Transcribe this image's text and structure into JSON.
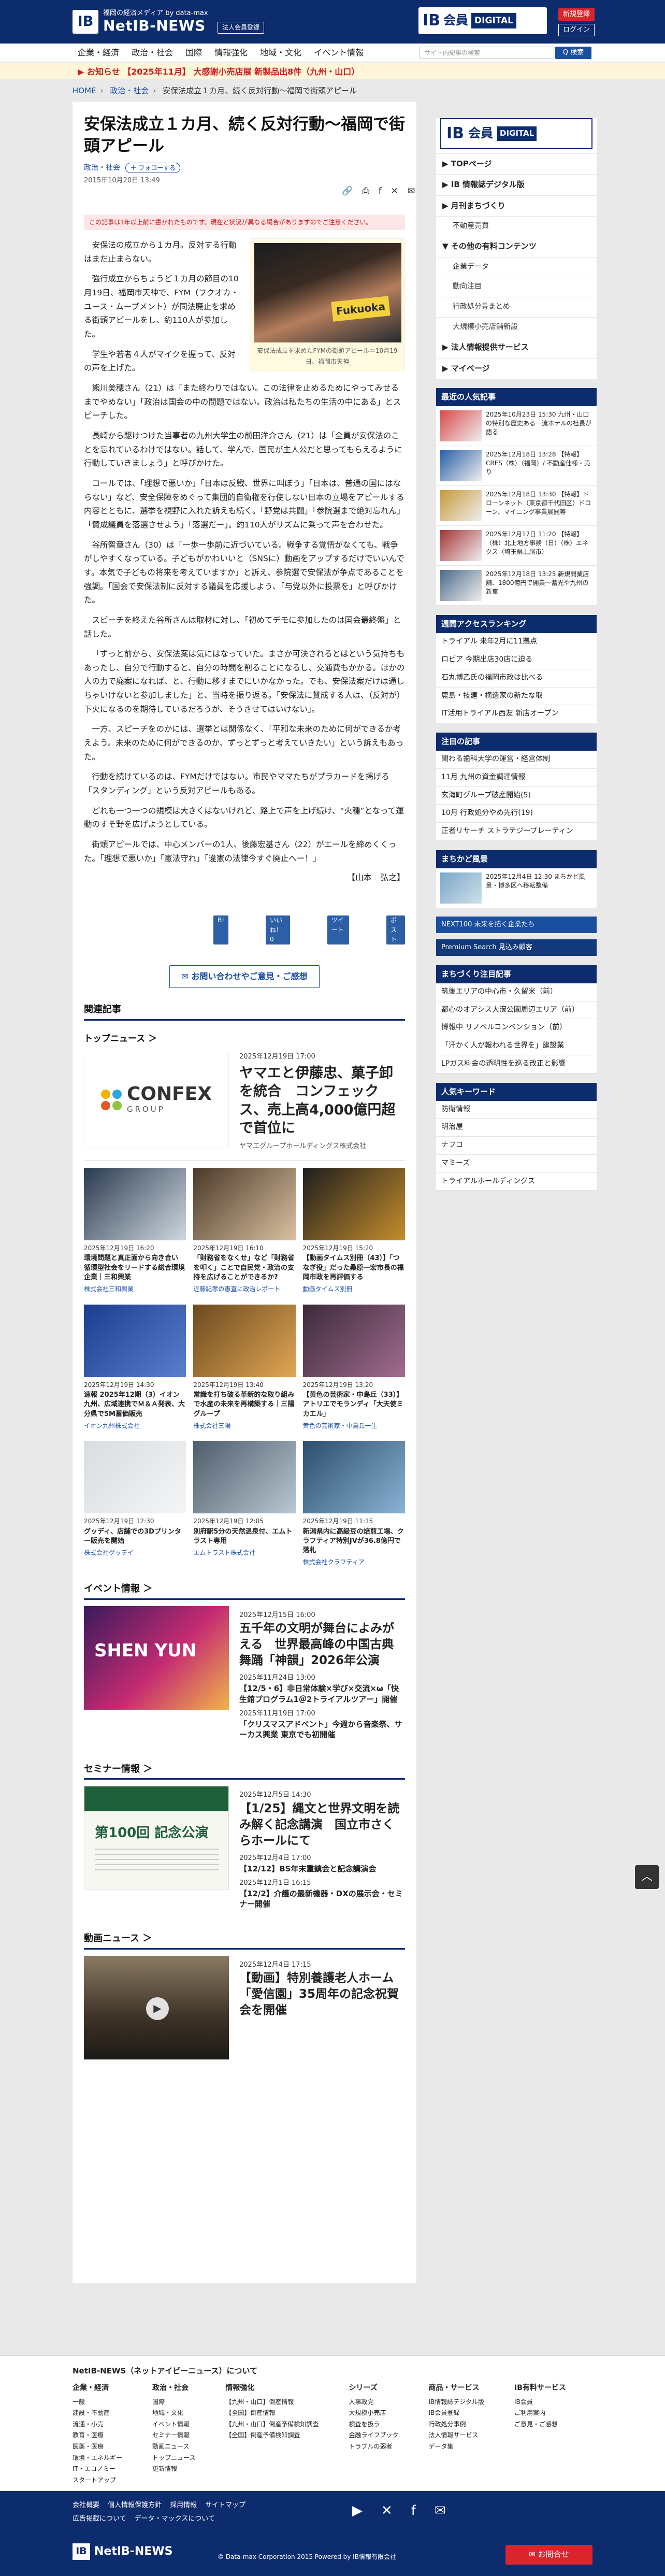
{
  "header": {
    "logo_mark": "IB",
    "logo_sub": "福岡の経済メディア by data-max",
    "logo_name": "NetIB-NEWS",
    "login_pill": "法人会員登録",
    "ib": "IB",
    "member": "会員",
    "digital": "DIGITAL",
    "register": "新規登録",
    "login": "ログイン"
  },
  "nav": {
    "items": [
      "企業・経済",
      "政治・社会",
      "国際",
      "情報強化",
      "地域・文化",
      "イベント情報"
    ],
    "search_placeholder": "サイト内記事の検索",
    "search_button": "Q 検索"
  },
  "notice": "▶ お知らせ  【2025年11月】 大感謝小売店展 新製品出8件（九州・山口）",
  "breadcrumb": [
    "HOME",
    "政治・社会",
    "安保法成立１カ月、続く反対行動～福岡で街頭アピール"
  ],
  "article": {
    "title": "安保法成立１カ月、続く反対行動～福岡で街頭アピール",
    "category": "政治・社会",
    "follow": "＋ フォローする",
    "date": "2015年10月20日 13:49",
    "old_note": "この記事は1年以上前に書かれたものです。現在と状況が異なる場合がありますのでご注意ください。",
    "photo_sign": "Fukuoka",
    "photo_caption": "安保法成立を求めたFYMの街頭アピール＝10月19日、福岡市天神",
    "paragraphs": [
      "安保法の成立から１カ月。反対する行動はまだ止まらない。",
      "強行成立からちょうど１カ月の節目の10月19日、福岡市天神で、FYM（フクオカ・ユース・ムーブメント）が同法廃止を求める街頭アピールをし、約110人が参加した。",
      "学生や若者４人がマイクを握って、反対の声を上げた。",
      "熊川美穂さん（21）は「また終わりではない。この法律を止めるためにやってみせるまでやめない」「政治は国会の中の問題ではない。政治は私たちの生活の中にある」とスピーチした。",
      "長崎から駆けつけた当事者の九州大学生の前田洋介さん（21）は「全員が安保法のことを忘れているわけではない。話して、学んで、国民が主人公だと思ってもらえるように行動していきましょう」と呼びかけた。",
      "コールでは、「理想で悪いか」「日本は反戦、世界に叫ぼう」「日本は、普通の国にはならない」など、安全保障をめぐって集団的自衛権を行使しない日本の立場をアピールする内容とともに、選挙を視野に入れた訴えも続く。「野党は共闘」「参院選まで絶対忘れん」「賛成議員を落選させよう」「落選だー」。約110人がリズムに乗って声を合わせた。",
      "谷所智章さん（30）は「一歩一歩前に近づいている。戦争する覚悟がなくても、戦争がしやすくなっている。子どもがかわいいと（SNSに）動画をアップするだけでいいんです。本気で子どもの将来を考えていますか」と訴え、参院選で安保法が争点であることを強調。「国会で安保法制に反対する議員を応援しよう、「与党以外に投票を」と呼びかけた。",
      "スピーチを終えた谷所さんは取材に対し、「初めてデモに参加したのは国会最終盤」と話した。",
      "「ずっと前から、安保法案は気にはなっていた。まさか可決されるとはという気持ちもあったし、自分で行動すると、自分の時間を削ることになるし、交通費もかかる。ほかの人の力で廃案になれば、と、行動に移すまでにいかなかった。でも、安保法案だけは通しちゃいけないと参加しました」と、当時を振り返る。「安保法に賛成する人は、（反対が）下火になるのを期待しているだろうが、そうさせてはいけない」。",
      "一方、スピーチをのかには、選挙とは関係なく、「平和な未来のために何ができるか考えよう。未来のために何ができるのか、ずっとずっと考えていきたい」という訴えもあった。",
      "行動を続けているのは、FYMだけではない。市民やママたちがプラカードを掲げる「スタンディング」という反対アピールもある。",
      "どれも一つ一つの規模は大きくはないけれど、路上で声を上げ続け、“火種”となって運動のすそ野を広げようとしている。",
      "街頭アピールでは、中心メンバーの1人、後藤宏基さん（22）がエールを締めくくった。「理想で悪いか」「憲法守れ」「違憲の法律今すぐ廃止へー！」"
    ],
    "author": "【山本　弘之】",
    "small_buttons": [
      "B!",
      "いいね！0",
      "ツイート",
      "ポスト"
    ],
    "contact": "✉ お問い合わせやご意見・ご感想"
  },
  "related": {
    "heading": "関連記事",
    "topnews_label": "トップニュース ＞",
    "top_item": {
      "logo_word": "CONFEX",
      "logo_sub": "GROUP",
      "date": "2025年12月19日 17:00",
      "title": "ヤマエと伊藤忠、菓子卸を統合　コンフェックス、売上高4,000億円超で首位に",
      "company": "ヤマエグループホールディングス株式会社"
    },
    "grid": [
      {
        "date": "2025年12月19日 16:20",
        "title": "環境問題と真正面から向き合い 循環型社会をリードする総合環境企業｜三和興業",
        "company": "株式会社三和興業"
      },
      {
        "date": "2025年12月19日 16:10",
        "title": "「財務省をなくせ」など「財務省を叩く」ことで自民党・政治の支持を広げることができるか?",
        "company": "近藤紀孝の愚直に政治レポート"
      },
      {
        "date": "2025年12月19日 15:20",
        "title": "【動画タイムス別冊（43）】「つなぎ役」だった桑原一宏市長の福岡市政を再評価する",
        "company": "動画タイムス別冊"
      },
      {
        "date": "2025年12月19日 14:30",
        "title": "速報 2025年12期（3）イオン九州、広域連携でＭ＆Ａ発表、大分県で5M蓄価販売",
        "company": "イオン九州株式会社"
      },
      {
        "date": "2025年12月19日 13:40",
        "title": "常識を打ち破る革新的な取り組みで水産の未来を再構築する｜三陽グループ",
        "company": "株式会社三陽"
      },
      {
        "date": "2025年12月19日 13:20",
        "title": "【黄色の芸術家・中島丘（33）】アトリエでモランディ「大天使ミカエル」",
        "company": "黄色の芸術家・中島丘一生"
      },
      {
        "date": "2025年12月19日 12:30",
        "title": "グッディ、店舗での3Dプリンター販売を開始",
        "company": "株式会社グッデイ"
      },
      {
        "date": "2025年12月19日 12:05",
        "title": "別府駅5分の天然温泉付、エムトラスト専用",
        "company": "エムトラスト株式会社"
      },
      {
        "date": "2025年12月19日 11:15",
        "title": "新潟県内に高級豆の焙煎工場、クラフティア特別JVが36.8億円で落札",
        "company": "株式会社クラフティア"
      }
    ]
  },
  "events": {
    "heading": "イベント情報 ＞",
    "img_text": "SHEN YUN",
    "items": [
      {
        "date": "2025年12月15日 16:00",
        "title": "五千年の文明が舞台によみがえる　世界最高峰の中国古典舞踊「神韻」2026年公演",
        "big": true
      },
      {
        "date": "2025年11月24日 13:00",
        "title": "【12/5・6】非日常体験×学び×交流×ω「快生館プログラム1＠2トライアルツアー」開催",
        "big": false
      },
      {
        "date": "2025年11月19日 17:00",
        "title": "「クリスマスアドベント」今週から音楽祭、サーカス興業 東京でも初開催",
        "big": false
      }
    ]
  },
  "seminars": {
    "heading": "セミナー情報 ＞",
    "img_text": "第100回 記念公演",
    "items": [
      {
        "date": "2025年12月5日 14:30",
        "title": "【1/25】縄文と世界文明を読み解く記念講演　国立市さくらホールにて",
        "big": true
      },
      {
        "date": "2025年12月4日 17:00",
        "title": "【12/12】BS年末重鎮会と記念講演会",
        "big": false
      },
      {
        "date": "2025年12月1日 16:15",
        "title": "【12/2】介護の最新機器・DXの展示会・セミナー開催",
        "big": false
      }
    ]
  },
  "videos": {
    "heading": "動画ニュース ＞",
    "item": {
      "date": "2025年12月4日 17:15",
      "title": "【動画】特別養護老人ホーム「愛信園」35周年の記念祝賀会を開催"
    }
  },
  "sidebar": {
    "ib": "IB",
    "member": "会員",
    "digital": "DIGITAL",
    "menu": [
      {
        "label": "▶ TOPページ",
        "child": false
      },
      {
        "label": "▶ IB 情報誌デジタル版",
        "child": false
      },
      {
        "label": "▶ 月刊まちづくり",
        "child": false
      },
      {
        "label": "不動産売買",
        "child": true
      },
      {
        "label": "▼ その他の有料コンテンツ",
        "child": false
      },
      {
        "label": "企業データ",
        "child": true
      },
      {
        "label": "動向注目",
        "child": true
      },
      {
        "label": "行政処分등まとめ",
        "child": true
      },
      {
        "label": "大規模小売店舗新設",
        "child": true
      },
      {
        "label": "▶ 法人情報提供サービス",
        "child": false
      },
      {
        "label": "▶ マイページ",
        "child": false
      }
    ],
    "popular_heading": "最近の人気記事",
    "popular": [
      "2025年10月23日 15:30 九州・山口の特別な歴史ある一流ホテルの社長が語る",
      "2025年12月18日 13:28 【特報】CRES（株）（福岡）/ 不動産仕様・売り",
      "2025年12月18日 13:30 【特報】ドローンネット（東京都千代田区）ドローン、マイニング事業展開等",
      "2025年12月17日 11:20 【特報】（株）北上地方事務（日）（株）エネクス（埼玉県上尾市）",
      "2025年12月18日 13:25 新規開業店舗、1800億円で開業～蓄光や九州の新車"
    ],
    "access_heading": "週間アクセスランキング",
    "access": [
      "トライアル 来年2月に11拠点",
      "ロピア 今期出店30店に迫る",
      "石丸博乙氏の福岡市政は比べる",
      "鹿島・技建・構造家の新たな取",
      "IT活用トライアル西友 新店オープン"
    ],
    "feature_heading": "注目の記事",
    "feature": [
      "関わる歯科大学の運営・経営体制",
      "11月 九州の資金調達情報",
      "玄海町グループ破産開始(5)",
      "10月 行政処分やめ先行(19)",
      "正者リサーチ ストラテジーブレーティン"
    ],
    "town_heading": "まちかど風景",
    "town": "2025年12月4日 12:30 まちかど風景・博多区へ移転整備",
    "nxt": "NEXT100 未来を拓く企業たち",
    "premium": "Premium Search 見込み顧客",
    "pickup_heading": "まちづくり注目記事",
    "pickup": [
      "筑後エリアの中心市・久留米（前）",
      "都心のオアシス大濠公園周辺エリア（前）",
      "博報中 リノベルコンベンション（前）",
      "「汗かく人が報われる世界を」建設業",
      "LPガス料金の透明性を巡る改正と影響"
    ],
    "keyword_heading": "人気キーワード",
    "keywords": [
      "防衛情報",
      "明治屋",
      "ナフコ",
      "マミーズ",
      "トライアルホールディングス"
    ]
  },
  "footer": {
    "heading": "NetIB-NEWS（ネットアイビーニュース）について",
    "cols": [
      {
        "h": "企業・経済",
        "items": [
          "一般",
          "建設・不動産",
          "流通・小売",
          "教育・医療",
          "医薬・医療",
          "環境・エネルギー",
          "IT・エコノミー",
          "スタートアップ"
        ]
      },
      {
        "h": "政治・社会",
        "items": [
          "国際",
          "地域・文化",
          "イベント情報",
          "セミナー情報",
          "動画ニュース",
          "トップニュース",
          "更新情報"
        ]
      },
      {
        "h": "情報強化",
        "items": [
          "【九州・山口】倒産情報",
          "【全国】倒産情報",
          "【九州・山口】倒産予備検知調査",
          "【全国】倒産予備検知調査"
        ]
      },
      {
        "h": "シリーズ",
        "items": [
          "人事政党",
          "大規模小売店",
          "検査を扱う",
          "金融ライフブック",
          "トラブルの弱者"
        ]
      },
      {
        "h": "商品・サービス",
        "items": [
          "IB情報誌デジタル版",
          "IB会員登録",
          "行政処分事例",
          "法人情報サービス",
          "データ集"
        ]
      },
      {
        "h": "IB有料サービス",
        "items": [
          "IB会員",
          "ご利用案内",
          "ご意見・ご感想"
        ]
      }
    ],
    "links": [
      "会社概要",
      "個人情報保護方針",
      "採用情報",
      "サイトマップ"
    ],
    "links2": [
      "広告掲載について",
      "データ・マックスについて"
    ],
    "social": [
      "▶",
      "✕",
      "f",
      "✉"
    ],
    "flogo": "NetIB-NEWS",
    "copy": "© Data-max Corporation 2015   Powered by IB情報有限会社",
    "reg": "✉ お問合せ"
  },
  "to_top": "︿"
}
